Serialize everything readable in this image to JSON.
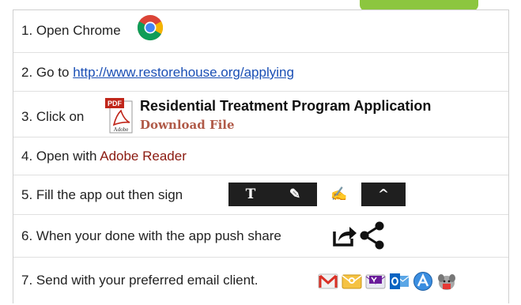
{
  "steps": [
    {
      "text": "1. Open Chrome"
    },
    {
      "prefix": "2. Go to ",
      "link": "http://www.restorehouse.org/applying"
    },
    {
      "prefix": "3. Click on",
      "program_title": "Residential Treatment Program Application",
      "download": "Download File",
      "pdf_badge": "PDF",
      "adobe_badge": "Adobe"
    },
    {
      "prefix": "4. Open with ",
      "app": "Adobe Reader"
    },
    {
      "text": "5. Fill the app out then sign"
    },
    {
      "text": "6. When your done with the app push share"
    },
    {
      "text": "7. Send with your preferred email client."
    }
  ],
  "toolbar": {
    "text_tool": "T",
    "pen_tool": "✎",
    "sign_tool": "✍",
    "collapse": "^"
  },
  "icons": {
    "chrome": "chrome-icon",
    "share": "share-icon",
    "share_alt": "share-nodes-icon"
  },
  "email_clients": [
    "gmail-icon",
    "mail-icon",
    "yahoo-mail-icon",
    "outlook-icon",
    "email-app-icon",
    "k9-mail-icon"
  ],
  "colors": {
    "accent_tab": "#8cc63f",
    "link": "#1a4fb5",
    "adobe_text": "#8b1a10"
  }
}
